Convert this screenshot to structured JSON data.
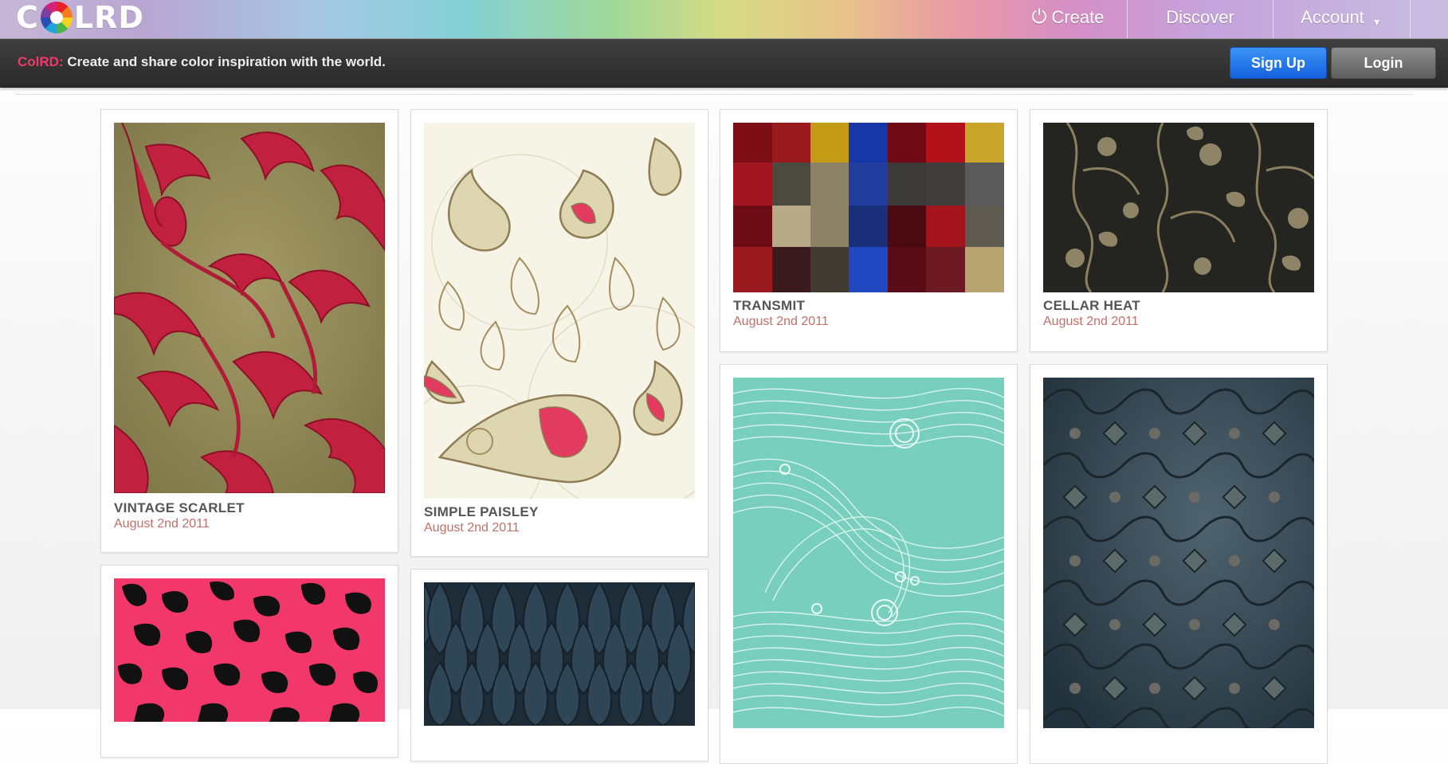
{
  "nav": {
    "logo_first": "C",
    "logo_rest": "LRD",
    "logo_icon": "color-wheel-icon",
    "create_label": "Create",
    "create_icon": "power-icon",
    "discover_label": "Discover",
    "account_label": "Account",
    "account_icon": "caret-down-icon"
  },
  "header": {
    "brand": "ColRD:",
    "tagline": "Create and share color inspiration with the world.",
    "signup_label": "Sign Up",
    "login_label": "Login"
  },
  "colors": {
    "brand_pink": "#ef3a6a",
    "date_color": "#c0706a",
    "signup_blue": "#1461df"
  },
  "patterns": [
    {
      "title": "VINTAGE SCARLET",
      "date": "August 2nd 2011"
    },
    {
      "title": "SIMPLE PAISLEY",
      "date": "August 2nd 2011"
    },
    {
      "title": "TRANSMIT",
      "date": "August 2nd 2011"
    },
    {
      "title": "CELLAR HEAT",
      "date": "August 2nd 2011"
    },
    {
      "title": "",
      "date": ""
    },
    {
      "title": "",
      "date": ""
    },
    {
      "title": "",
      "date": ""
    },
    {
      "title": "",
      "date": ""
    }
  ]
}
